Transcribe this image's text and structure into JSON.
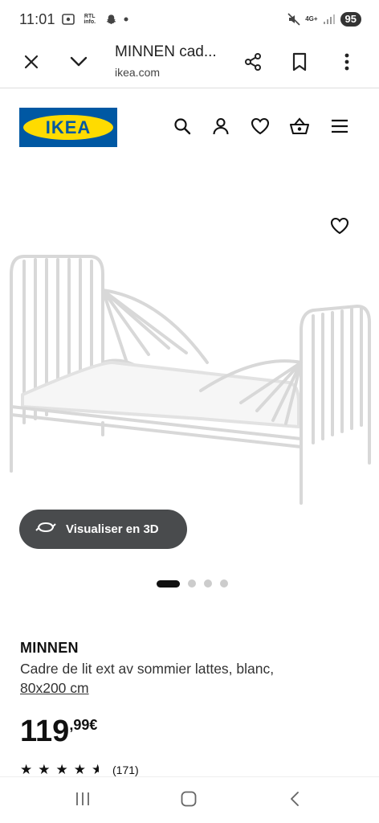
{
  "status_bar": {
    "time": "11:01",
    "rtl_label": "RTL info.",
    "network": "4G+",
    "battery": "95"
  },
  "browser": {
    "page_title": "MINNEN cad...",
    "url": "ikea.com"
  },
  "ikea": {
    "logo_text": "IKEA"
  },
  "product": {
    "view_3d_label": "Visualiser en 3D",
    "carousel": {
      "count": 4,
      "active": 1
    },
    "name": "MINNEN",
    "description": "Cadre de lit ext av sommier lattes, blanc,",
    "size": "80x200 cm",
    "price_integer": "119",
    "price_decimal": ",99€",
    "rating": 4.5,
    "review_count": "(171)"
  },
  "colors": {
    "ikea_blue": "#0058a3",
    "ikea_yellow": "#ffdb00",
    "button_dark": "#494b4d"
  },
  "icons": {
    "status": [
      "screenshot-icon",
      "snapchat-icon",
      "mute-icon",
      "signal-icon"
    ],
    "browser": [
      "close-icon",
      "chevron-down-icon",
      "share-icon",
      "bookmark-icon",
      "more-vert-icon"
    ],
    "header": [
      "search-icon",
      "user-icon",
      "heart-icon",
      "basket-icon",
      "menu-icon"
    ],
    "nav": [
      "recents-icon",
      "home-icon",
      "back-icon"
    ]
  }
}
